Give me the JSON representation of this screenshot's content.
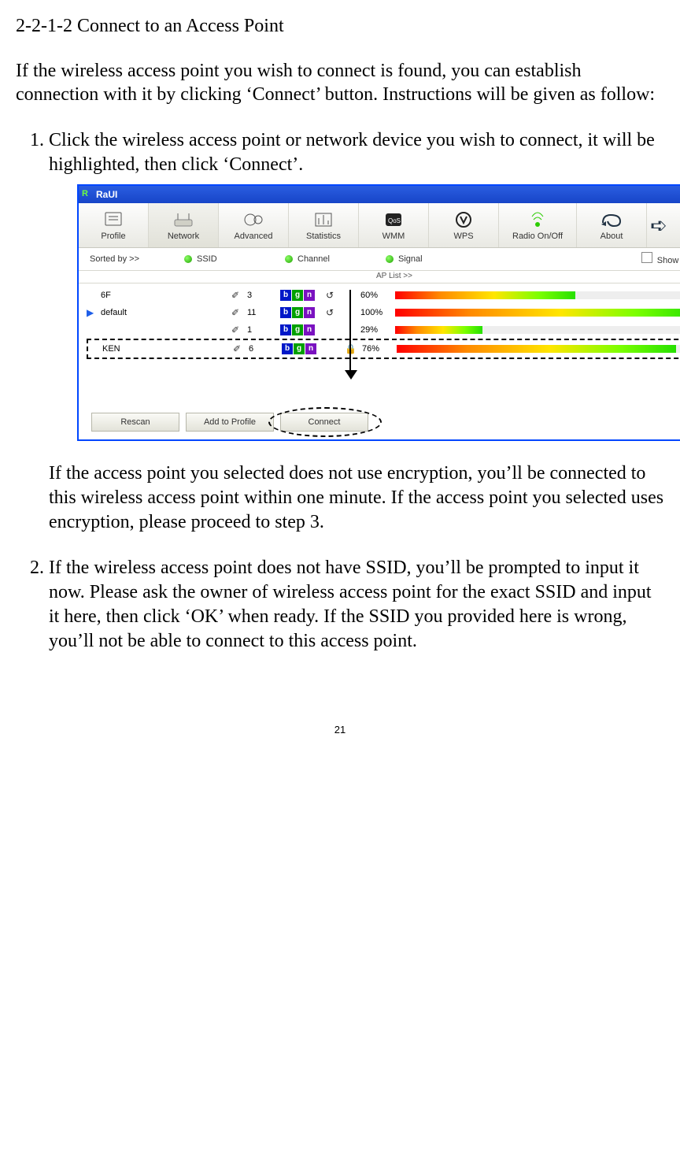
{
  "section_title": "2-2-1-2 Connect to an Access Point",
  "intro": "If the wireless access point you wish to connect is found, you can establish connection with it by clicking ‘Connect’ button. Instructions will be given as follow:",
  "step1": "Click the wireless access point or network device you wish to connect, it will be highlighted, then click ‘Connect’.",
  "after_fig": "If the access point you selected does not use encryption, you’ll be connected to this wireless access point within one minute. If the access point you selected uses encryption, please proceed to step 3.",
  "step2": "If the wireless access point does not have SSID, you’ll be prompted to input it now. Please ask the owner of wireless access point for the exact SSID and input it here, then click ‘OK’ when ready. If the SSID you provided here is wrong, you’ll not be able to connect to this access point.",
  "page_number": "21",
  "app": {
    "title": "RaUI",
    "tabs": {
      "profile": "Profile",
      "network": "Network",
      "advanced": "Advanced",
      "statistics": "Statistics",
      "wmm": "WMM",
      "wps": "WPS",
      "radio": "Radio On/Off",
      "about": "About"
    },
    "sortrow": {
      "label": "Sorted by >>",
      "ssid": "SSID",
      "channel": "Channel",
      "signal": "Signal",
      "show_dbm": "Show dBm"
    },
    "aplist_label": "AP List >>",
    "rows": [
      {
        "ssid": "6F",
        "channel": "3",
        "modes": [
          "b",
          "g",
          "n"
        ],
        "wps": true,
        "secure": false,
        "pct": "60%",
        "bar": 60,
        "current": false,
        "selected_ken": false
      },
      {
        "ssid": "default",
        "channel": "11",
        "modes": [
          "b",
          "g",
          "n"
        ],
        "wps": true,
        "secure": false,
        "pct": "100%",
        "bar": 100,
        "current": true,
        "selected_ken": false
      },
      {
        "ssid": "",
        "channel": "1",
        "modes": [
          "b",
          "g",
          "n"
        ],
        "wps": false,
        "secure": false,
        "pct": "29%",
        "bar": 29,
        "current": false,
        "selected_ken": false
      },
      {
        "ssid": "KEN",
        "channel": "6",
        "modes": [
          "b",
          "g",
          "n"
        ],
        "wps": false,
        "secure": true,
        "pct": "76%",
        "bar": 94,
        "current": false,
        "selected_ken": true
      }
    ],
    "actions": {
      "rescan": "Rescan",
      "add_to_profile": "Add to Profile",
      "connect": "Connect"
    }
  }
}
